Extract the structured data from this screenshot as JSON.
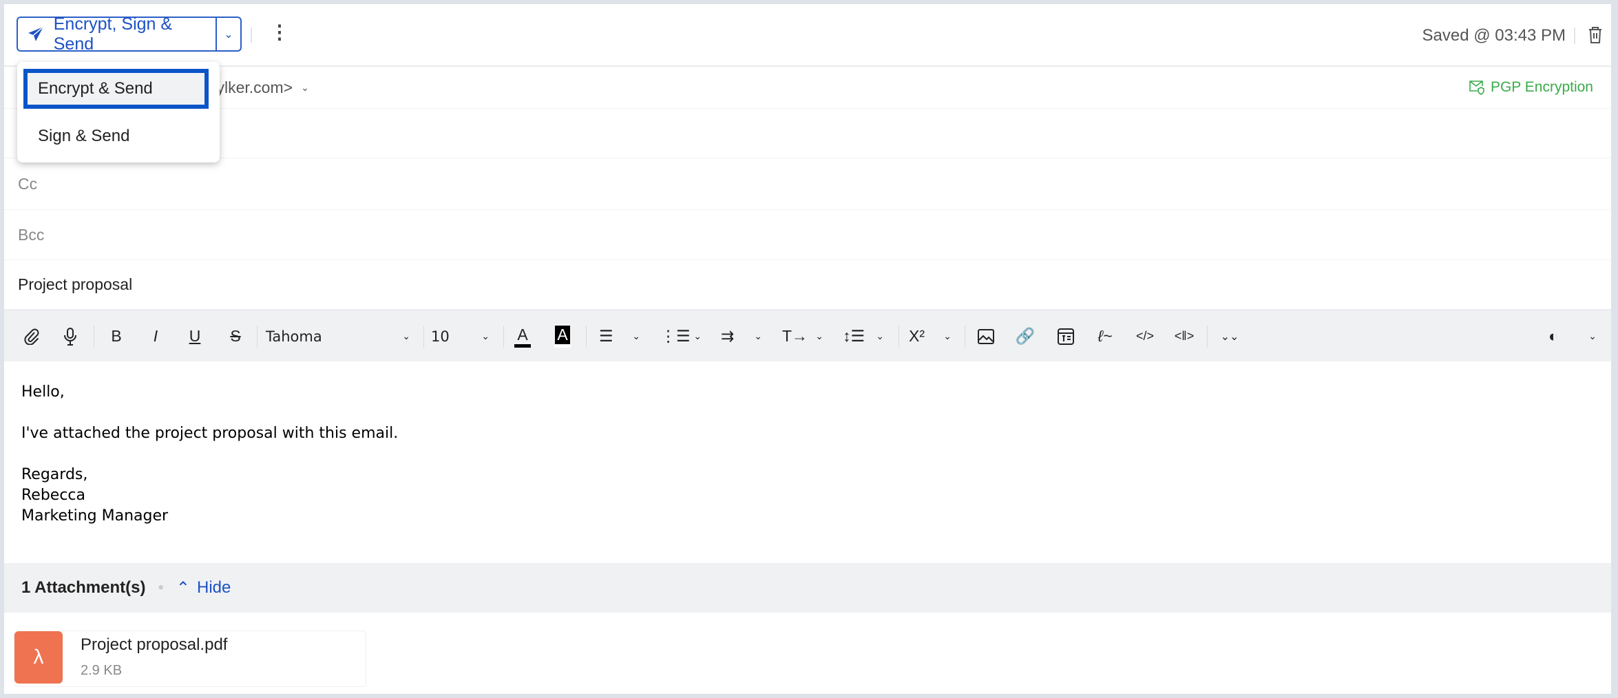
{
  "header": {
    "send_button": "Encrypt, Sign & Send",
    "saved_status": "Saved @ 03:43 PM"
  },
  "send_menu": {
    "items": [
      {
        "label": "Encrypt & Send",
        "selected": true
      },
      {
        "label": "Sign & Send",
        "selected": false
      }
    ]
  },
  "from": {
    "value_partial": "zylker.com>",
    "encryption_label": "PGP Encryption",
    "encryption_color": "#3aab4a"
  },
  "fields": {
    "cc_label": "Cc",
    "bcc_label": "Bcc",
    "subject": "Project proposal"
  },
  "toolbar": {
    "font": "Tahoma",
    "size": "10",
    "superscript": "X²"
  },
  "body": {
    "lines": [
      "Hello,",
      "",
      "I've attached the project proposal with this email.",
      "",
      "Regards,",
      "Rebecca",
      "Marketing Manager"
    ]
  },
  "attachments": {
    "count_label": "1 Attachment(s)",
    "hide_label": "Hide",
    "files": [
      {
        "name": "Project proposal.pdf",
        "size": "2.9 KB"
      }
    ]
  },
  "colors": {
    "accent": "#1d52c3",
    "pdf": "#ef7350"
  }
}
